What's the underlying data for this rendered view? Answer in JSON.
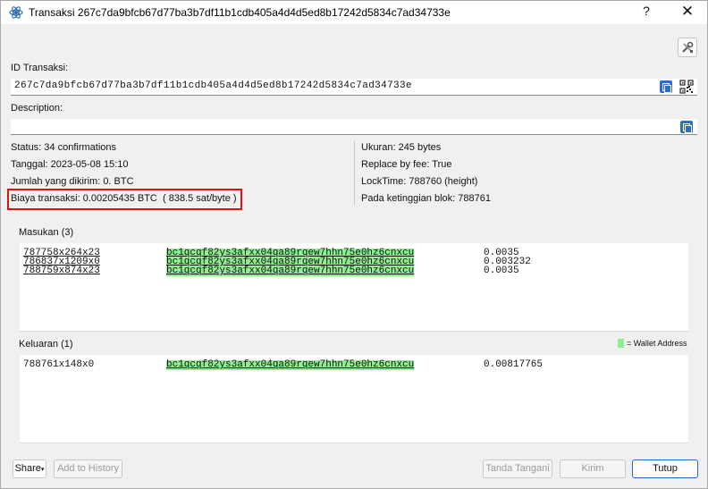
{
  "window": {
    "title": "Transaksi 267c7da9bfcb67d77ba3b7df11b1cdb405a4d4d5ed8b17242d5834c7ad34733e",
    "help": "?",
    "close": "✕"
  },
  "txid": {
    "label": "ID Transaksi:",
    "value": "267c7da9bfcb67d77ba3b7df11b1cdb405a4d4d5ed8b17242d5834c7ad34733e"
  },
  "description": {
    "label": "Description:",
    "value": ""
  },
  "info_left": {
    "status": "Status: 34 confirmations",
    "date": "Tanggal: 2023-05-08 15:10",
    "amount": "Jumlah yang dikirim: 0. BTC",
    "fee": "Biaya transaksi: 0.00205435 BTC  ( 838.5 sat/byte )"
  },
  "info_right": {
    "size": "Ukuran: 245 bytes",
    "rbf": "Replace by fee: True",
    "locktime": "LockTime: 788760 (height)",
    "height": "Pada ketinggian blok: 788761"
  },
  "inputs": {
    "label": "Masukan (3)",
    "rows": [
      {
        "outpoint": "787758x264x23",
        "address": "bc1qcqf82ys3afxx04qa89rqew7hhn75e0hz6cnxcu",
        "amount": "0.0035"
      },
      {
        "outpoint": "786837x1209x0",
        "address": "bc1qcqf82ys3afxx04qa89rqew7hhn75e0hz6cnxcu",
        "amount": "0.003232"
      },
      {
        "outpoint": "788759x874x23",
        "address": "bc1qcqf82ys3afxx04qa89rqew7hhn75e0hz6cnxcu",
        "amount": "0.0035"
      }
    ]
  },
  "outputs": {
    "label": "Keluaran (1)",
    "legend": "= Wallet Address",
    "rows": [
      {
        "outpoint": "788761x148x0",
        "address": "bc1qcqf82ys3afxx04qa89rqew7hhn75e0hz6cnxcu",
        "amount": "0.00817765"
      }
    ]
  },
  "buttons": {
    "share": "Share",
    "add_history": "Add to History",
    "sign": "Tanda Tangani",
    "broadcast": "Kirim",
    "close": "Tutup"
  },
  "colors": {
    "wallet_highlight": "#90ee90",
    "fee_box": "#e01010",
    "accent": "#1f67c8"
  },
  "icons": {
    "title": "electrum-icon",
    "tools": "tools-icon",
    "copy": "copy-icon",
    "qr": "qr-code-icon"
  }
}
